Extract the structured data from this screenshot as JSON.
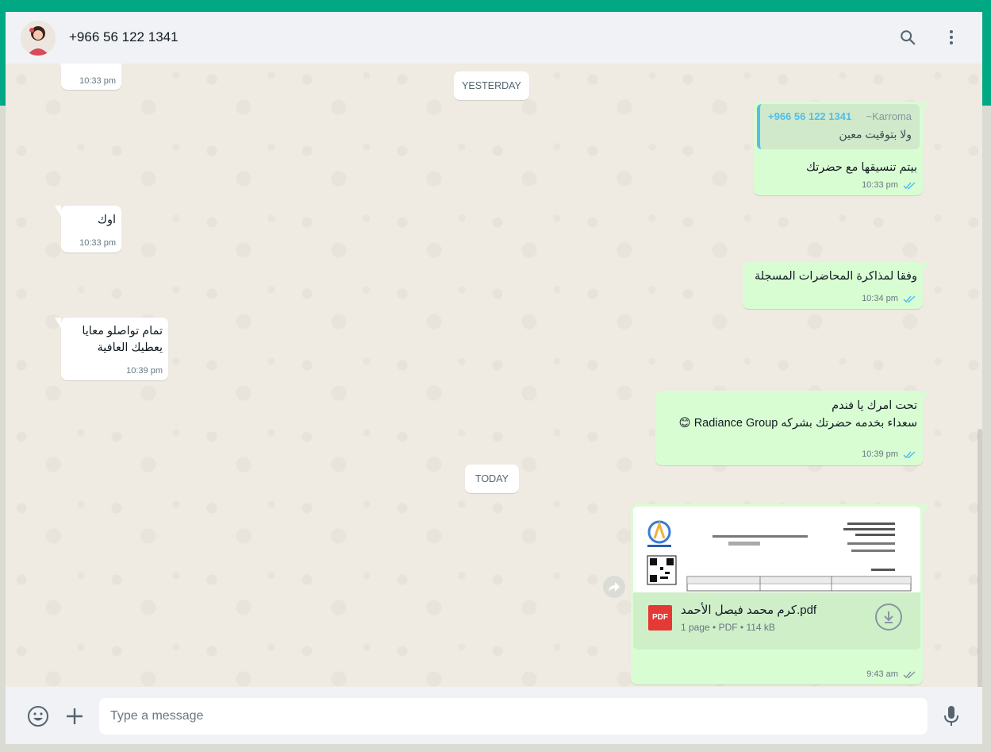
{
  "header": {
    "title": "+966 56 122 1341"
  },
  "dates": {
    "yesterday": "YESTERDAY",
    "today": "TODAY"
  },
  "messages": {
    "m1": {
      "time": "10:33 pm"
    },
    "m2": {
      "quote_name": "+966 56 122 1341",
      "quote_pushname": "~Karroma",
      "quote_text": "ولا بتوقيت معين",
      "text": "بيتم تنسيقها مع حضرتك",
      "time": "10:33 pm"
    },
    "m3": {
      "text": "اوك",
      "time": "10:33 pm"
    },
    "m4": {
      "text": "وفقا لمذاكرة المحاضرات المسجلة",
      "time": "10:34 pm"
    },
    "m5": {
      "line1": "تمام تواصلو معايا",
      "line2": "يعطيك العافية",
      "time": "10:39 pm"
    },
    "m6": {
      "line1": "تحت امرك يا فندم",
      "line2": "سعداء بخدمه حضرتك بشركه Radiance Group 😊",
      "time": "10:39 pm"
    },
    "m7": {
      "file_name": "كرم محمد فيصل الأحمد.pdf",
      "file_meta": "1 page • PDF • 114 kB",
      "file_type_label": "PDF",
      "time": "9:43 am"
    }
  },
  "composer": {
    "placeholder": "Type a message"
  },
  "colors": {
    "accent": "#00a884",
    "outgoing": "#d9fdd3",
    "incoming": "#ffffff",
    "read_tick": "#53bdeb",
    "chat_bg": "#efeae2"
  },
  "icons": [
    "avatar",
    "search-icon",
    "menu-icon",
    "double-check-icon",
    "forward-icon",
    "pdf-icon",
    "download-icon",
    "emoji-icon",
    "plus-icon",
    "microphone-icon"
  ]
}
